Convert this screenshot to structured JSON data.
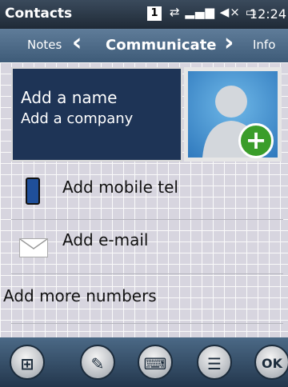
{
  "status_bar": {
    "app_title": "Contacts",
    "notification_count": "1",
    "time": "12:24"
  },
  "tabs": {
    "left": "Notes",
    "active": "Communicate",
    "right": "Info"
  },
  "name_card": {
    "name_placeholder": "Add a name",
    "company_placeholder": "Add a company"
  },
  "fields": {
    "mobile": "Add mobile tel",
    "email": "Add e-mail",
    "more_numbers": "Add more numbers"
  },
  "softkeys": {
    "ok_label": "OK"
  }
}
